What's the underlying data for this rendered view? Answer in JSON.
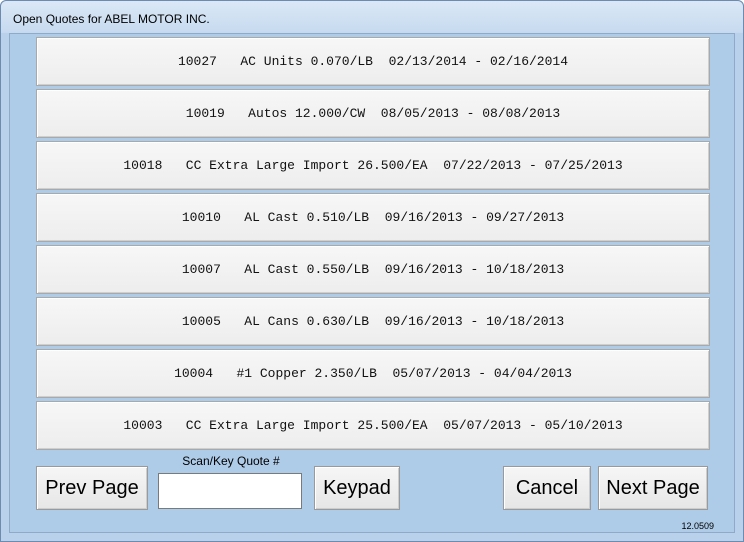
{
  "window": {
    "title": "Open Quotes for ABEL MOTOR INC."
  },
  "quotes": [
    {
      "label": "10027   AC Units 0.070/LB  02/13/2014 - 02/16/2014"
    },
    {
      "label": "10019   Autos 12.000/CW  08/05/2013 - 08/08/2013"
    },
    {
      "label": "10018   CC Extra Large Import 26.500/EA  07/22/2013 - 07/25/2013"
    },
    {
      "label": "10010   AL Cast 0.510/LB  09/16/2013 - 09/27/2013"
    },
    {
      "label": "10007   AL Cast 0.550/LB  09/16/2013 - 10/18/2013"
    },
    {
      "label": "10005   AL Cans 0.630/LB  09/16/2013 - 10/18/2013"
    },
    {
      "label": "10004   #1 Copper 2.350/LB  05/07/2013 - 04/04/2013"
    },
    {
      "label": "10003   CC Extra Large Import 25.500/EA  05/07/2013 - 05/10/2013"
    }
  ],
  "controls": {
    "prev_label": "Prev Page",
    "scan_label": "Scan/Key Quote #",
    "scan_value": "",
    "keypad_label": "Keypad",
    "cancel_label": "Cancel",
    "next_label": "Next Page"
  },
  "version": "12.0509",
  "colors": {
    "client_background": "#aecbe8",
    "button_face": "#f0f0f0"
  }
}
